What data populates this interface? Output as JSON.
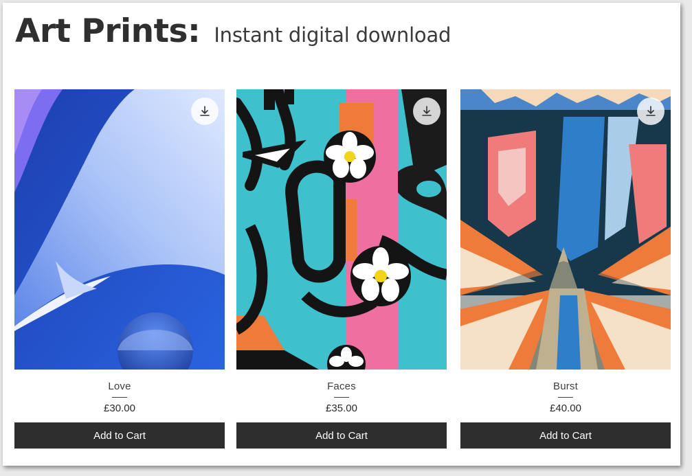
{
  "header": {
    "title": "Art Prints:",
    "subtitle": "Instant digital download"
  },
  "products": [
    {
      "name": "Love",
      "price": "£30.00",
      "button_label": "Add to Cart",
      "download_icon": "download-icon"
    },
    {
      "name": "Faces",
      "price": "£35.00",
      "button_label": "Add to Cart",
      "download_icon": "download-icon"
    },
    {
      "name": "Burst",
      "price": "£40.00",
      "button_label": "Add to Cart",
      "download_icon": "download-icon"
    }
  ],
  "colors": {
    "button_bg": "#2e2e2e",
    "button_text": "#ffffff",
    "title_text": "#2f2f2f"
  }
}
